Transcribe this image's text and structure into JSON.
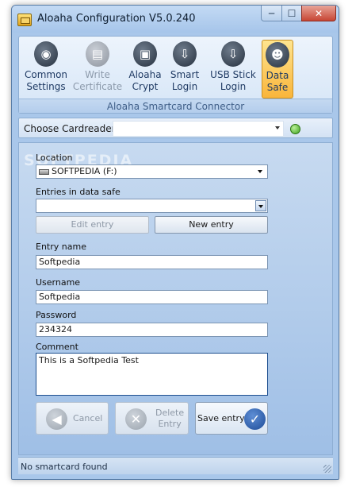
{
  "window": {
    "title": "Aloaha Configuration V5.0.240",
    "controls": {
      "minimize": "─",
      "maximize": "☐",
      "close": "✕"
    }
  },
  "ribbon": {
    "items": [
      {
        "line1": "Common",
        "line2": "Settings",
        "icon": "globe-icon",
        "state": "normal"
      },
      {
        "line1": "Write",
        "line2": "Certificate",
        "icon": "certificate-icon",
        "state": "disabled"
      },
      {
        "line1": "Aloaha",
        "line2": "Crypt",
        "icon": "lock-icon",
        "state": "normal"
      },
      {
        "line1": "Smart",
        "line2": "Login",
        "icon": "smart-login-icon",
        "state": "normal"
      },
      {
        "line1": "USB Stick",
        "line2": "Login",
        "icon": "usb-login-icon",
        "state": "normal"
      },
      {
        "line1": "Data",
        "line2": "Safe",
        "icon": "users-icon",
        "state": "active"
      }
    ],
    "group_label": "Aloaha Smartcard Connector"
  },
  "cardreader": {
    "label": "Choose Cardreader",
    "value": "",
    "status_color": "#3ea21c"
  },
  "watermark": "SOFTPEDIA",
  "location": {
    "label": "Location",
    "value": "SOFTPEDIA (F:)",
    "icon": "drive-icon"
  },
  "entries": {
    "label": "Entries in data safe",
    "value": ""
  },
  "buttons": {
    "edit_entry": "Edit entry",
    "new_entry": "New entry"
  },
  "entry_name": {
    "label": "Entry name",
    "value": "Softpedia"
  },
  "username": {
    "label": "Username",
    "value": "Softpedia"
  },
  "password": {
    "label": "Password",
    "value": "234324"
  },
  "comment": {
    "label": "Comment",
    "value": "This is a Softpedia Test"
  },
  "actions": {
    "cancel": "Cancel",
    "delete_line1": "Delete",
    "delete_line2": "Entry",
    "save": "Save entry"
  },
  "status": {
    "text": "No smartcard found"
  },
  "colors": {
    "accent": "#f9b53b",
    "window_bg": "#a9c7ea"
  }
}
